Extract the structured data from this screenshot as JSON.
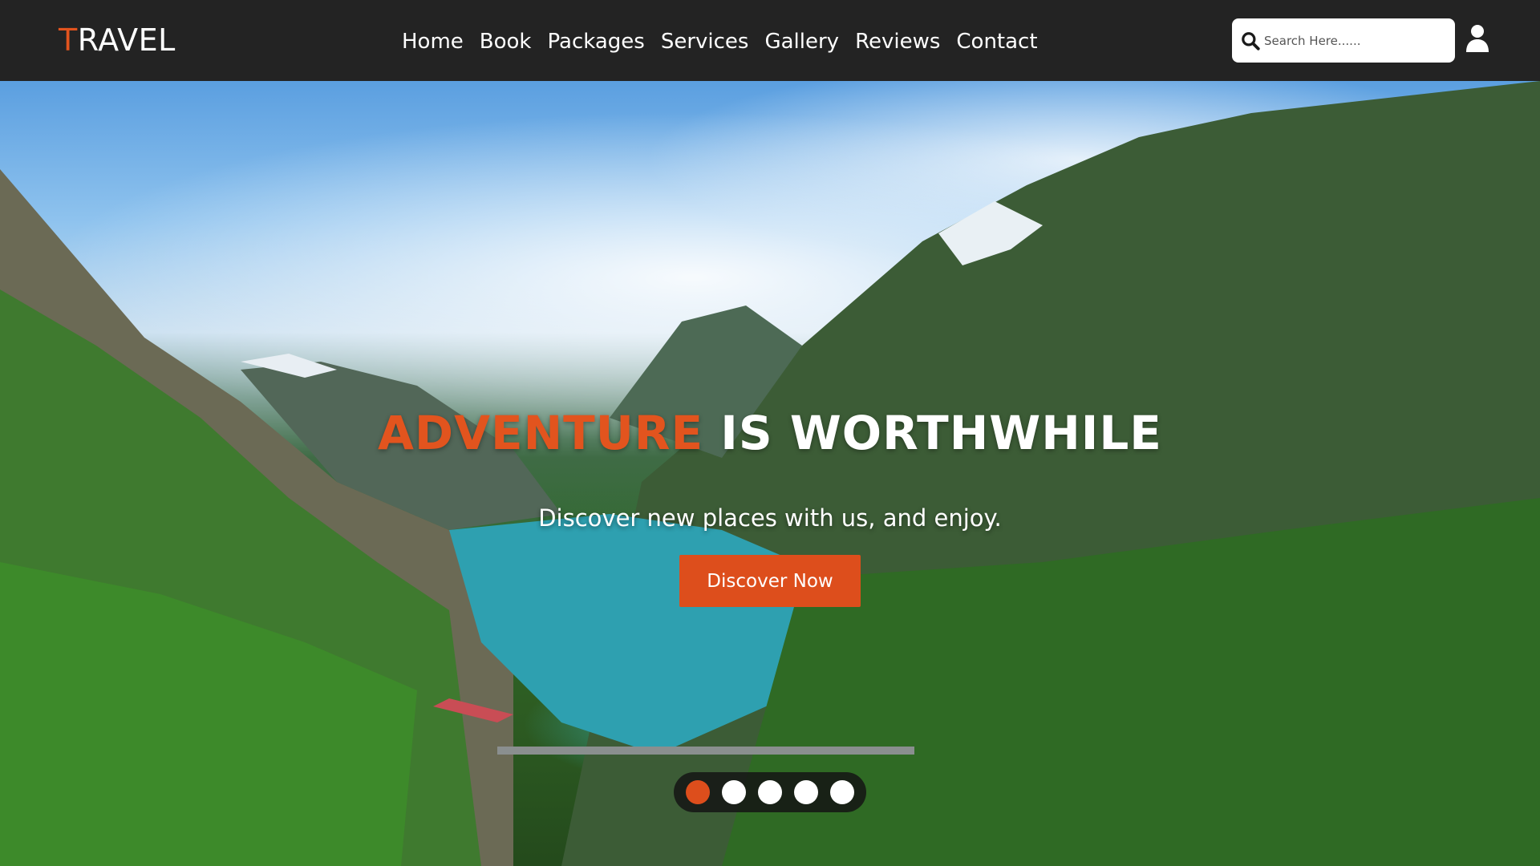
{
  "header": {
    "logo_first": "T",
    "logo_rest": "RAVEL",
    "nav": [
      {
        "label": "Home"
      },
      {
        "label": "Book"
      },
      {
        "label": "Packages"
      },
      {
        "label": "Services"
      },
      {
        "label": "Gallery"
      },
      {
        "label": "Reviews"
      },
      {
        "label": "Contact"
      }
    ],
    "search": {
      "placeholder": "Search Here......",
      "value": "",
      "icon": "search-icon"
    },
    "user_icon": "user-icon"
  },
  "hero": {
    "title_accent": "ADVENTURE",
    "title_rest": " IS WORTHWHILE",
    "subtitle": "Discover new places with us, and enjoy.",
    "button_label": "Discover Now",
    "slides_total": 5,
    "active_slide": 1
  },
  "colors": {
    "accent": "#dd4e1c",
    "header_bg": "#232323",
    "text": "#ffffff"
  }
}
